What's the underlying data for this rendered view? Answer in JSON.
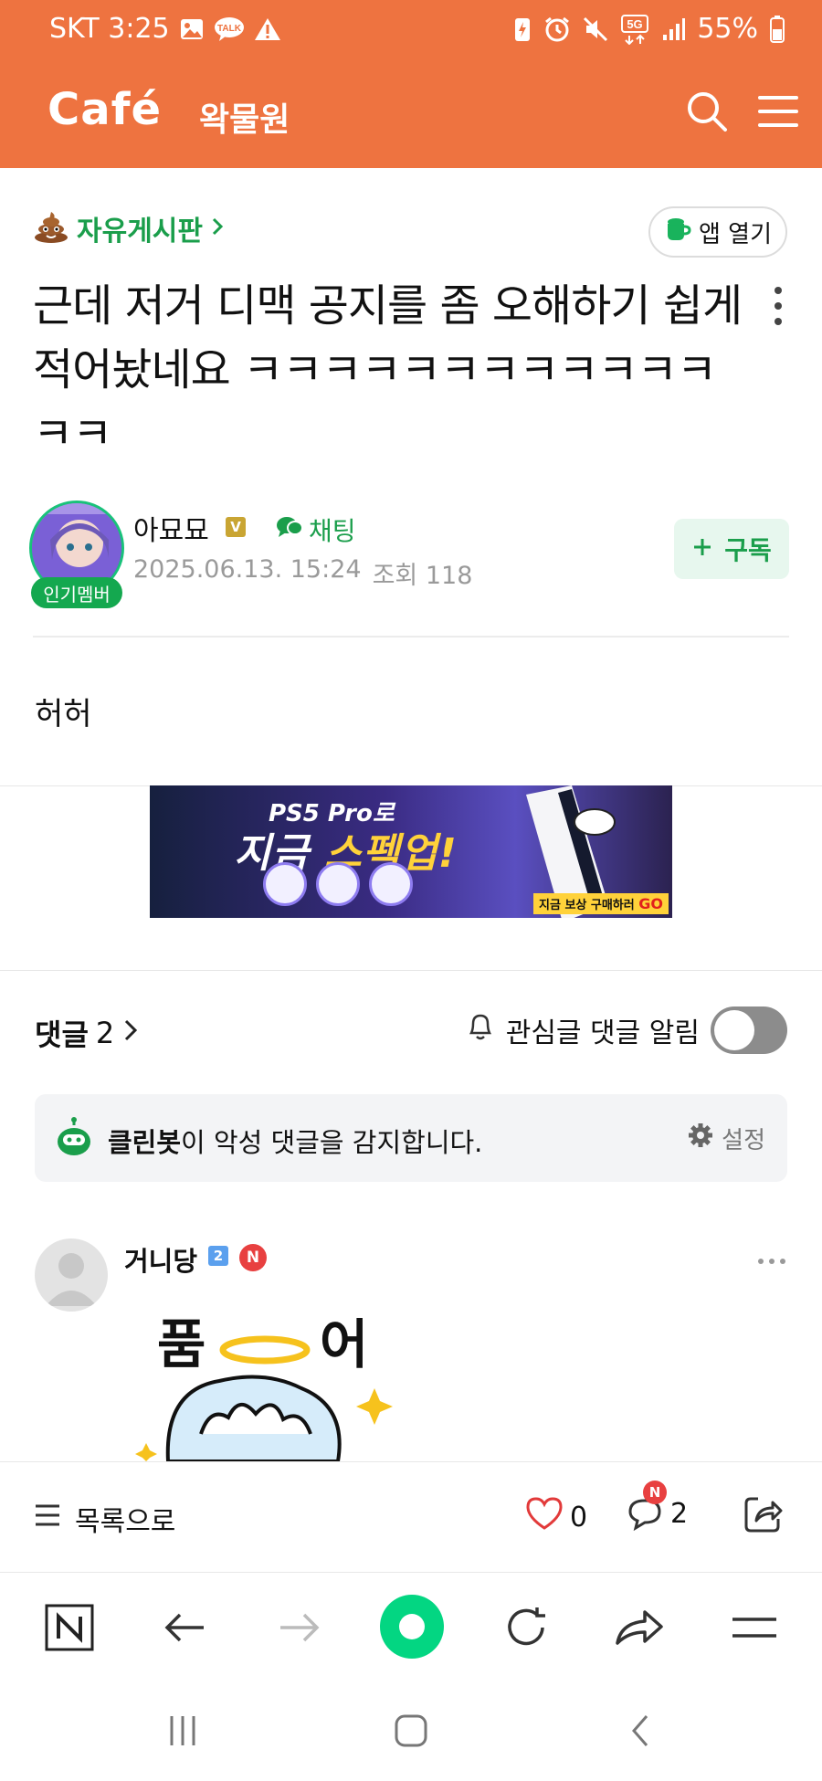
{
  "status_bar": {
    "carrier_time": "SKT 3:25",
    "talk_icon_label": "TALK",
    "network": "5G",
    "battery": "55%"
  },
  "header": {
    "logo": "Café",
    "cafe_name": "왁물원"
  },
  "post": {
    "board": "자유게시판",
    "app_open_label": "앱 열기",
    "title": "근데 저거 디맥 공지를 좀 오해하기 쉽게 적어놨네요 ㅋㅋㅋㅋㅋㅋㅋㅋㅋㅋㅋㅋㅋㅋ",
    "author": "아묘묘",
    "author_level": "V",
    "author_badge": "인기멤버",
    "chat_label": "채팅",
    "date": "2025.06.13. 15:24",
    "views": "조회 118",
    "subscribe_label": "구독",
    "body": "허허"
  },
  "banner": {
    "line1": "PS5 Pro로",
    "line2a": "지금 ",
    "line2b": "스펙업!",
    "cta": "지금 보상 구매하러",
    "cta_go": "GO"
  },
  "comments": {
    "title": "댓글",
    "count": "2",
    "notify_label": "관심글 댓글 알림",
    "notify_on": false,
    "cleanbot_name": "클린봇",
    "cleanbot_text": "이 악성 댓글을 감지합니다.",
    "cleanbot_settings": "설정",
    "first": {
      "name": "거니당",
      "level": "2",
      "new_badge": "N",
      "sticker_text_1": "품",
      "sticker_text_2": "어"
    }
  },
  "action_bar": {
    "list_label": "목록으로",
    "likes": "0",
    "comments": "2",
    "comments_badge": "N"
  },
  "colors": {
    "brand": "#ee7340",
    "green": "#1a9e4b",
    "naver_green": "#03c75a"
  }
}
